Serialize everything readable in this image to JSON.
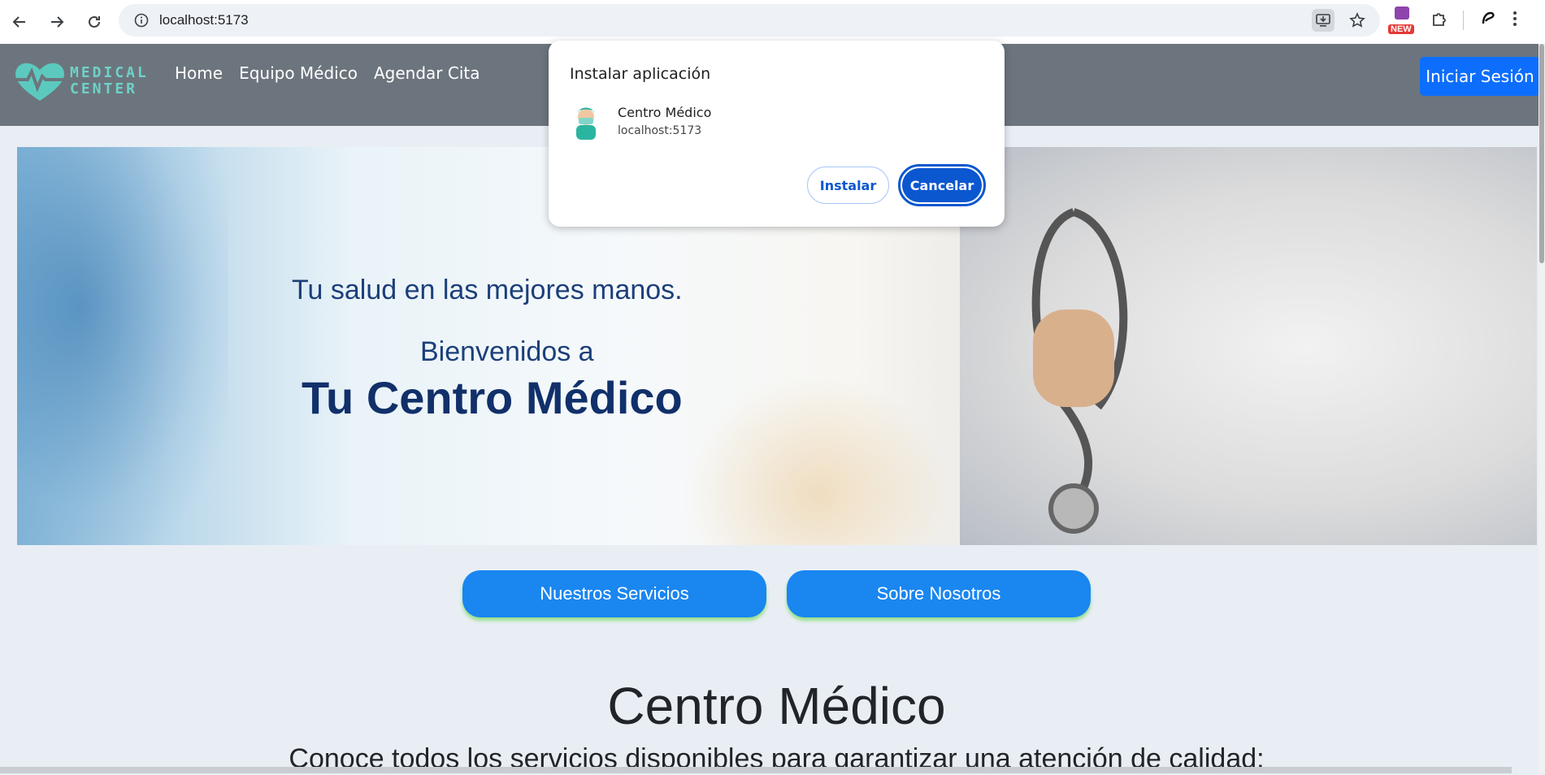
{
  "browser": {
    "url": "localhost:5173",
    "extension_badge": "NEW"
  },
  "site": {
    "logo_line1": "MEDICAL",
    "logo_line2": "CENTER",
    "nav": [
      "Home",
      "Equipo Médico",
      "Agendar Cita"
    ],
    "login_label": "Iniciar Sesión"
  },
  "hero": {
    "line1": "Tu salud en las mejores manos.",
    "line2": "Bienvenidos a",
    "line3": "Tu Centro Médico"
  },
  "buttons": {
    "services": "Nuestros Servicios",
    "about": "Sobre Nosotros"
  },
  "section": {
    "title": "Centro Médico",
    "subtitle": "Conoce todos los servicios disponibles para garantizar una atención de calidad:"
  },
  "install_dialog": {
    "title": "Instalar aplicación",
    "app_name": "Centro Médico",
    "app_url": "localhost:5173",
    "install_label": "Instalar",
    "cancel_label": "Cancelar"
  },
  "colors": {
    "nav_bg": "#6c757d",
    "primary": "#0d6efd",
    "pill": "#1a86f0",
    "dialog_accent": "#0b57d0"
  }
}
